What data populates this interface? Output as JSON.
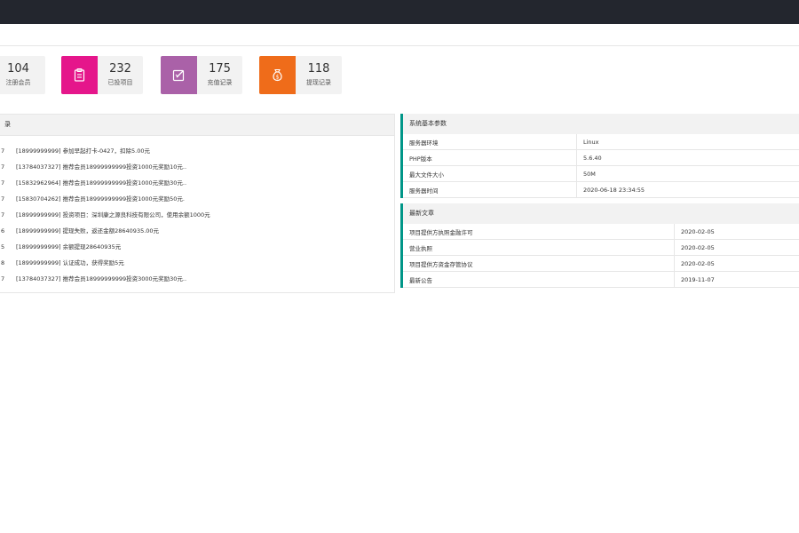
{
  "stats": [
    {
      "number": "104",
      "label": "注册会员",
      "color": "#f2f2f2",
      "icon": "user-icon"
    },
    {
      "number": "232",
      "label": "已投项目",
      "color": "#e5168b",
      "icon": "clipboard-icon"
    },
    {
      "number": "175",
      "label": "充值记录",
      "color": "#aa61a8",
      "icon": "edit-icon"
    },
    {
      "number": "118",
      "label": "提现记录",
      "color": "#ef6c1a",
      "icon": "money-bag-icon"
    }
  ],
  "log_panel": {
    "title": "录",
    "rows": [
      {
        "d": "7",
        "text": "[18999999999] 参加早起打卡-0427，扣除5.00元"
      },
      {
        "d": "7",
        "text": "[13784037327] 推荐会员18999999999投资1000元奖励10元.."
      },
      {
        "d": "7",
        "text": "[15832962964] 推荐会员18999999999投资1000元奖励30元.."
      },
      {
        "d": "7",
        "text": "[15830704262] 推荐会员18999999999投资1000元奖励50元."
      },
      {
        "d": "7",
        "text": "[18999999999] 投资项目：深圳康之源良科技有限公司，使用余额1000元"
      },
      {
        "d": "6",
        "text": "[18999999999] 提现失败，返还金额28640935.00元"
      },
      {
        "d": "5",
        "text": "[18999999999] 余额提现28640935元"
      },
      {
        "d": "8",
        "text": "[18999999999] 认证成功，获得奖励5元"
      },
      {
        "d": "7",
        "text": "[13784037327] 推荐会员18999999999投资3000元奖励30元.."
      }
    ]
  },
  "system_params": {
    "title": "系统基本参数",
    "rows": [
      {
        "key": "服务器环境",
        "value": "Linux"
      },
      {
        "key": "PHP版本",
        "value": "5.6.40"
      },
      {
        "key": "最大文件大小",
        "value": "50M"
      },
      {
        "key": "服务器时间",
        "value": "2020-06-18 23:34:55"
      }
    ]
  },
  "latest_articles": {
    "title": "最新文章",
    "rows": [
      {
        "title": "项目提供方执照金融许可",
        "date": "2020-02-05"
      },
      {
        "title": "营业执照",
        "date": "2020-02-05"
      },
      {
        "title": "项目提供方资金存管协议",
        "date": "2020-02-05"
      },
      {
        "title": "最新公告",
        "date": "2019-11-07"
      }
    ]
  }
}
